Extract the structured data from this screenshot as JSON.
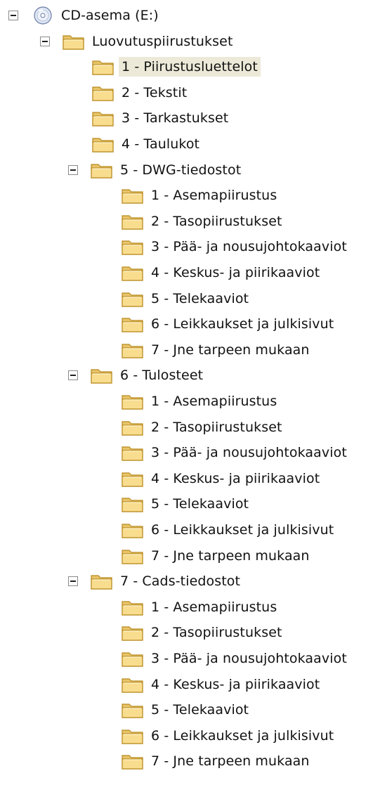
{
  "tree": {
    "root": {
      "label": "CD-asema (E:)",
      "icon": "cd-drive-icon",
      "expanded": true
    },
    "main_folder": {
      "label": "Luovutuspiirustukset",
      "icon": "folder-icon",
      "expanded": true
    },
    "top_items": [
      {
        "label": "1 - Piirustusluettelot",
        "selected": true
      },
      {
        "label": "2 - Tekstit"
      },
      {
        "label": "3 - Tarkastukset"
      },
      {
        "label": "4 - Taulukot"
      }
    ],
    "groups": [
      {
        "label": "5 - DWG-tiedostot",
        "expanded": true,
        "children": [
          "1 - Asemapiirustus",
          "2 - Tasopiirustukset",
          "3 - Pää- ja nousujohtokaaviot",
          "4 - Keskus- ja piirikaaviot",
          "5 - Telekaaviot",
          "6 - Leikkaukset ja julkisivut",
          "7 - Jne tarpeen mukaan"
        ]
      },
      {
        "label": "6 - Tulosteet",
        "expanded": true,
        "children": [
          "1 - Asemapiirustus",
          "2 - Tasopiirustukset",
          "3 - Pää- ja nousujohtokaaviot",
          "4 - Keskus- ja piirikaaviot",
          "5 - Telekaaviot",
          "6 - Leikkaukset ja julkisivut",
          "7 - Jne tarpeen mukaan"
        ]
      },
      {
        "label": "7 - Cads-tiedostot",
        "expanded": true,
        "children": [
          "1 - Asemapiirustus",
          "2 - Tasopiirustukset",
          "3 - Pää- ja nousujohtokaaviot",
          "4 - Keskus- ja piirikaaviot",
          "5 - Telekaaviot",
          "6 - Leikkaukset ja julkisivut",
          "7 - Jne tarpeen mukaan"
        ]
      }
    ],
    "colors": {
      "folder_fill": "#f7d98b",
      "folder_stroke": "#c79a2b",
      "selection": "#ece9d8"
    }
  }
}
